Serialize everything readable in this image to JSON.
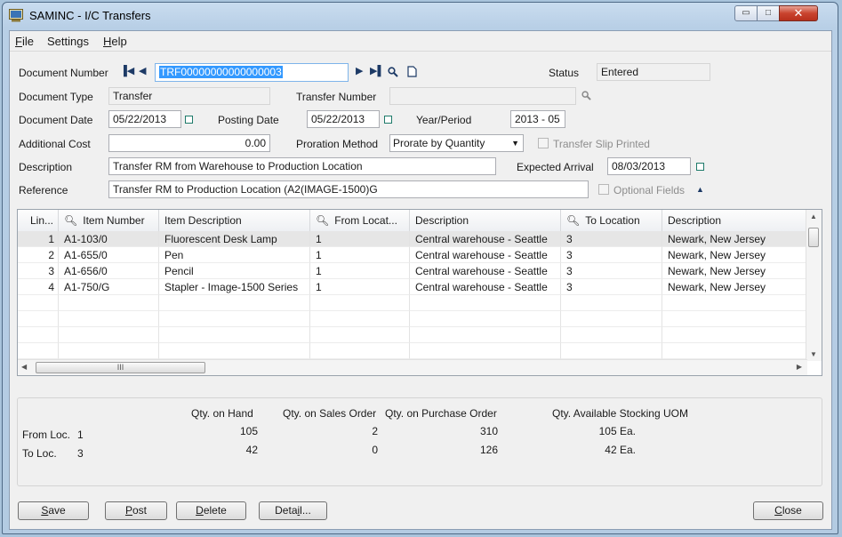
{
  "window": {
    "title": "SAMINC - I/C Transfers",
    "minimize_glyph": "▭",
    "maximize_glyph": "□",
    "close_glyph": "✕"
  },
  "menu": [
    {
      "key": "F",
      "rest": "ile"
    },
    {
      "key": "",
      "rest": "Settings"
    },
    {
      "key": "H",
      "rest": "elp"
    }
  ],
  "form": {
    "document_number": {
      "label": "Document Number",
      "value": "TRF00000000000000003"
    },
    "status": {
      "label": "Status",
      "value": "Entered"
    },
    "document_type": {
      "label": "Document Type",
      "value": "Transfer"
    },
    "transfer_number": {
      "label": "Transfer Number",
      "value": ""
    },
    "document_date": {
      "label": "Document Date",
      "value": "05/22/2013"
    },
    "posting_date": {
      "label": "Posting Date",
      "value": "05/22/2013"
    },
    "year_period": {
      "label": "Year/Period",
      "value": "2013 - 05"
    },
    "additional_cost": {
      "label": "Additional Cost",
      "value": "0.00"
    },
    "proration_method": {
      "label": "Proration Method",
      "value": "Prorate by Quantity"
    },
    "transfer_slip_printed": {
      "label": "Transfer Slip Printed"
    },
    "description": {
      "label": "Description",
      "value": "Transfer RM from Warehouse to Production Location"
    },
    "expected_arrival": {
      "label": "Expected Arrival",
      "value": "08/03/2013"
    },
    "reference": {
      "label": "Reference",
      "value": "Transfer RM to Production Location (A2(IMAGE-1500)G"
    },
    "optional_fields": {
      "label": "Optional Fields"
    }
  },
  "grid": {
    "headers": [
      "Lin...",
      "Item Number",
      "Item Description",
      "From Locat...",
      "Description",
      "To Location",
      "Description"
    ],
    "rows": [
      {
        "line": "1",
        "item": "A1-103/0",
        "desc": "Fluorescent Desk Lamp",
        "from": "1",
        "from_desc": "Central warehouse - Seattle",
        "to": "3",
        "to_desc": "Newark, New Jersey"
      },
      {
        "line": "2",
        "item": "A1-655/0",
        "desc": "Pen",
        "from": "1",
        "from_desc": "Central warehouse - Seattle",
        "to": "3",
        "to_desc": "Newark, New Jersey"
      },
      {
        "line": "3",
        "item": "A1-656/0",
        "desc": "Pencil",
        "from": "1",
        "from_desc": "Central warehouse - Seattle",
        "to": "3",
        "to_desc": "Newark, New Jersey"
      },
      {
        "line": "4",
        "item": "A1-750/G",
        "desc": "Stapler - Image-1500 Series",
        "from": "1",
        "from_desc": "Central warehouse - Seattle",
        "to": "3",
        "to_desc": "Newark, New Jersey"
      }
    ],
    "hscroll_grip": "III"
  },
  "quantities": {
    "headers": [
      "Qty. on Hand",
      "Qty. on Sales Order",
      "Qty. on Purchase Order",
      "Qty. Available Stocking UOM"
    ],
    "from": {
      "label": "From Loc.",
      "loc": "1",
      "on_hand": "105",
      "on_so": "2",
      "on_po": "310",
      "available": "105 Ea."
    },
    "to": {
      "label": "To Loc.",
      "loc": "3",
      "on_hand": "42",
      "on_so": "0",
      "on_po": "126",
      "available": "42 Ea."
    }
  },
  "buttons": {
    "save": {
      "key": "S",
      "rest": "ave"
    },
    "post": {
      "key": "P",
      "rest": "ost"
    },
    "delete": {
      "key": "D",
      "rest": "elete"
    },
    "detail": {
      "key": "Deta",
      "u": "i",
      "rest": "l..."
    },
    "close": {
      "key": "C",
      "rest": "lose"
    }
  }
}
